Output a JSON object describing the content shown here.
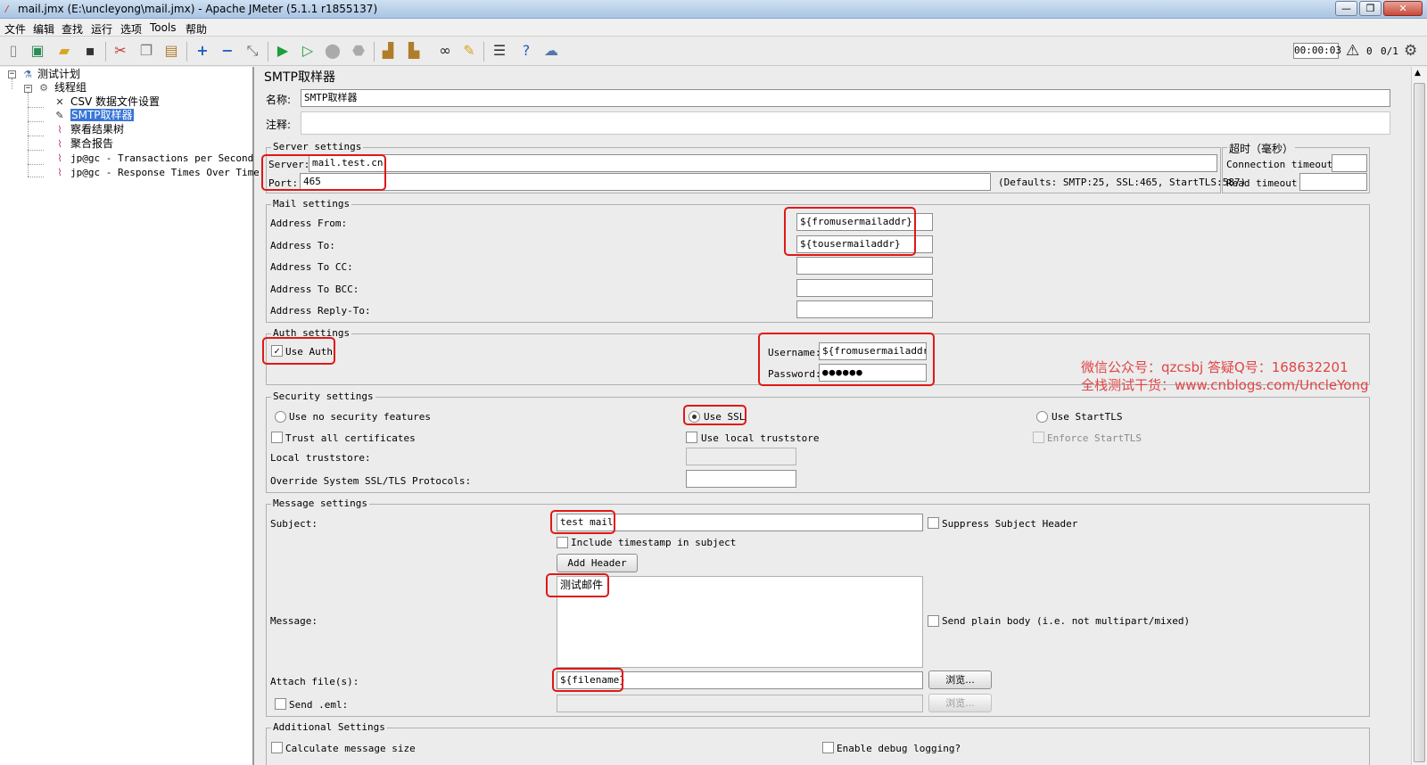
{
  "window": {
    "title": "mail.jmx (E:\\uncleyong\\mail.jmx) - Apache JMeter (5.1.1 r1855137)",
    "controls": [
      "—",
      "❐",
      "✕"
    ]
  },
  "menu": [
    "文件",
    "编辑",
    "查找",
    "运行",
    "选项",
    "Tools",
    "帮助"
  ],
  "toolbar": {
    "timer": "00:00:03",
    "warning_count": "0",
    "threads": "0/1"
  },
  "tree": {
    "items": [
      {
        "label": "测试计划"
      },
      {
        "label": "线程组"
      },
      {
        "label": "CSV 数据文件设置"
      },
      {
        "label": "SMTP取样器"
      },
      {
        "label": "察看结果树"
      },
      {
        "label": "聚合报告"
      },
      {
        "label": "jp@gc - Transactions per Second"
      },
      {
        "label": "jp@gc - Response Times Over Time"
      }
    ]
  },
  "panel": {
    "title": "SMTP取样器",
    "name_label": "名称:",
    "name_value": "SMTP取样器",
    "comment_label": "注释:",
    "comment_value": ""
  },
  "server": {
    "legend": "Server settings",
    "server_label": "Server:",
    "server_value": "mail.test.cn",
    "port_label": "Port:",
    "port_value": "465",
    "defaults": "(Defaults: SMTP:25, SSL:465, StartTLS:587)"
  },
  "timeout": {
    "legend": "超时（毫秒）",
    "connection_label": "Connection timeout:",
    "connection_value": "",
    "read_label": "Read timeout:",
    "read_value": ""
  },
  "mail": {
    "legend": "Mail settings",
    "from_label": "Address From:",
    "from_value": "${fromusermailaddr}",
    "to_label": "Address To:",
    "to_value": "${tousermailaddr}",
    "cc_label": "Address To CC:",
    "cc_value": "",
    "bcc_label": "Address To BCC:",
    "bcc_value": "",
    "reply_label": "Address Reply-To:",
    "reply_value": ""
  },
  "auth": {
    "legend": "Auth settings",
    "use_auth_label": "Use Auth",
    "use_auth_checked": true,
    "username_label": "Username:",
    "username_value": "${fromusermailaddr}",
    "password_label": "Password:",
    "password_value": "●●●●●●"
  },
  "security": {
    "legend": "Security settings",
    "no_security_label": "Use no security features",
    "ssl_label": "Use SSL",
    "starttls_label": "Use StartTLS",
    "selected": "ssl",
    "trust_all_label": "Trust all certificates",
    "local_truststore_cb_label": "Use local truststore",
    "enforce_starttls_label": "Enforce StartTLS",
    "local_truststore_label": "Local truststore:",
    "local_truststore_value": "",
    "override_label": "Override System SSL/TLS Protocols:",
    "override_value": ""
  },
  "message": {
    "legend": "Message settings",
    "subject_label": "Subject:",
    "subject_value": "test mail",
    "suppress_label": "Suppress Subject Header",
    "timestamp_label": "Include timestamp in subject",
    "add_header_label": "Add Header",
    "message_label": "Message:",
    "message_value": "测试邮件",
    "plain_body_label": "Send plain body (i.e. not multipart/mixed)",
    "attach_label": "Attach file(s):",
    "attach_value": "${filename}",
    "browse_label": "浏览...",
    "send_eml_label": "Send .eml:",
    "send_eml_value": "",
    "browse2_label": "浏览..."
  },
  "additional": {
    "legend": "Additional Settings",
    "calc_size_label": "Calculate message size",
    "debug_label": "Enable debug logging?"
  },
  "watermark": {
    "line1": "微信公众号：qzcsbj   答疑Q号：168632201",
    "line2": "全栈测试干货：www.cnblogs.com/UncleYong"
  },
  "colors": {
    "annotation": "#e01818",
    "selection": "#3875d7",
    "watermark": "#e04545"
  }
}
